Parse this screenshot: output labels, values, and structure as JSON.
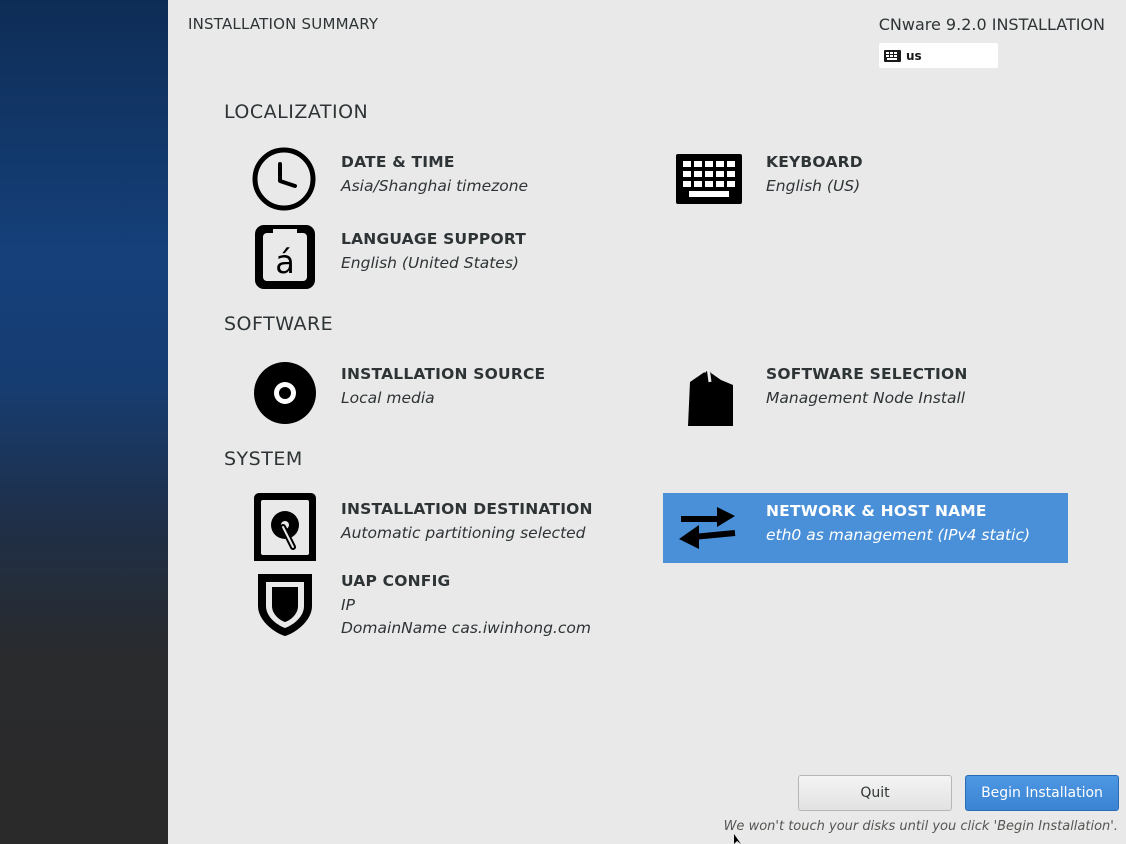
{
  "header": {
    "title": "INSTALLATION SUMMARY",
    "product": "CNware 9.2.0 INSTALLATION",
    "keyboard_layout": "us"
  },
  "sections": {
    "localization": "LOCALIZATION",
    "software": "SOFTWARE",
    "system": "SYSTEM"
  },
  "spokes": {
    "date_time": {
      "label": "DATE & TIME",
      "status": "Asia/Shanghai timezone",
      "icon": "clock-icon"
    },
    "keyboard": {
      "label": "KEYBOARD",
      "status": "English (US)",
      "icon": "keyboard-icon"
    },
    "language": {
      "label": "LANGUAGE SUPPORT",
      "status": "English (United States)",
      "icon": "language-icon"
    },
    "source": {
      "label": "INSTALLATION SOURCE",
      "status": "Local media",
      "icon": "disc-icon"
    },
    "software": {
      "label": "SOFTWARE SELECTION",
      "status": "Management Node Install",
      "icon": "package-icon"
    },
    "destination": {
      "label": "INSTALLATION DESTINATION",
      "status": "Automatic partitioning selected",
      "icon": "harddisk-icon"
    },
    "network": {
      "label": "NETWORK & HOST NAME",
      "status": "eth0 as management (IPv4 static)",
      "icon": "network-arrows-icon"
    },
    "uap": {
      "label": "UAP CONFIG",
      "status": "IP",
      "status2": "DomainName cas.iwinhong.com",
      "icon": "shield-icon"
    }
  },
  "buttons": {
    "quit": "Quit",
    "begin": "Begin Installation"
  },
  "footer": {
    "note": "We won't touch your disks until you click 'Begin Installation'."
  },
  "colors": {
    "selected": "#4a90d9",
    "begin_button": "#3a84d3",
    "background": "#e9e9e9"
  }
}
